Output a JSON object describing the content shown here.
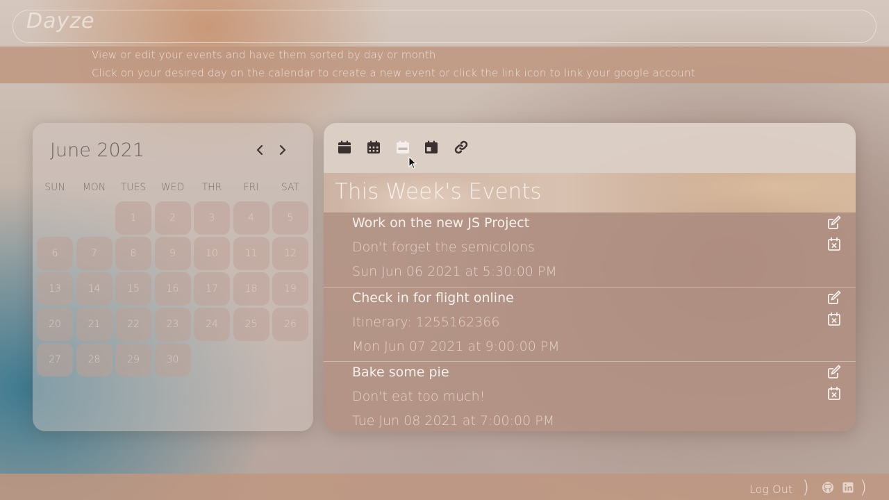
{
  "app": {
    "logo": "Dayze"
  },
  "info": {
    "line1": "View or edit your events and have them sorted by day or month",
    "line2": "Click on your desired day on the calendar to create a new event or click the link icon to link your google account"
  },
  "calendar": {
    "month_label": "June 2021",
    "prev_icon": "chevron-left-icon",
    "next_icon": "chevron-right-icon",
    "weekdays": [
      "SUN",
      "MON",
      "TUES",
      "WED",
      "THR",
      "FRI",
      "SAT"
    ],
    "days": [
      "1",
      "2",
      "3",
      "4",
      "5",
      "6",
      "7",
      "8",
      "9",
      "10",
      "11",
      "12",
      "13",
      "14",
      "15",
      "16",
      "17",
      "18",
      "19",
      "20",
      "21",
      "22",
      "23",
      "24",
      "25",
      "26",
      "27",
      "28",
      "29",
      "30"
    ]
  },
  "events_panel": {
    "toolbar_icons": [
      "calendar-day-icon",
      "calendar-month-icon",
      "calendar-week-icon",
      "calendar-today-icon",
      "link-icon"
    ],
    "title": "This Week's Events",
    "events": [
      {
        "name": "Work on the new JS Project",
        "description": "Don't forget the semicolons",
        "date": "Sun Jun 06 2021 at 5:30:00 PM"
      },
      {
        "name": "Check in for flight online",
        "description": "Itinerary: 1255162366",
        "date": "Mon Jun 07 2021 at 9:00:00 PM"
      },
      {
        "name": "Bake some pie",
        "description": "Don't eat too much!",
        "date": "Tue Jun 08 2021 at 7:00:00 PM"
      }
    ]
  },
  "footer": {
    "logout_label": "Log Out",
    "icons": [
      "github-icon",
      "linkedin-icon"
    ]
  }
}
